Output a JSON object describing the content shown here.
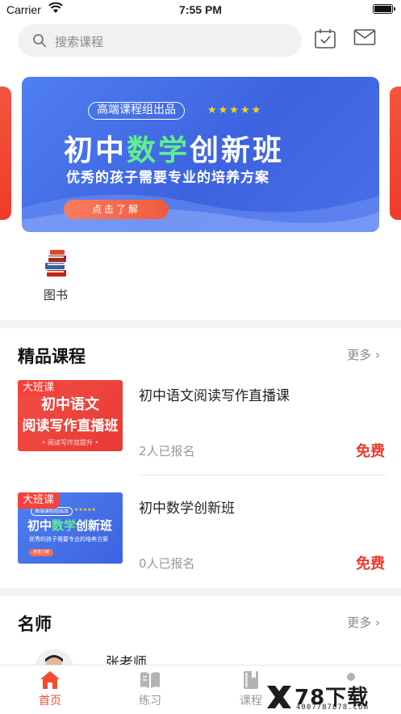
{
  "status_bar": {
    "carrier": "Carrier",
    "time": "7:55 PM"
  },
  "search": {
    "placeholder": "搜索课程"
  },
  "header_icons": [
    "calendar-check-icon",
    "mail-icon"
  ],
  "banner": {
    "tag": "高端课程组出品",
    "stars": "★★★★★",
    "headline_prefix": "初中",
    "headline_highlight": "数学",
    "headline_suffix": "创新班",
    "subtitle": "优秀的孩子需要专业的培养方案",
    "cta": "点击了解"
  },
  "categories": [
    {
      "label": "图书",
      "icon": "books-icon"
    }
  ],
  "featured": {
    "title": "精品课程",
    "more": "更多",
    "courses": [
      {
        "badge": "大班课",
        "thumb_line1": "初中语文",
        "thumb_line2": "阅读写作直播班",
        "thumb_line3": "• 阅读写作双提升 •",
        "title": "初中语文阅读写作直播课",
        "enrolled": "2人已报名",
        "price": "免费"
      },
      {
        "badge": "大班课",
        "thumb_tag": "高端课程组出品",
        "thumb_stars": "★★★★★",
        "thumb_prefix": "初中",
        "thumb_highlight": "数学",
        "thumb_suffix": "创新班",
        "thumb_sub": "优秀的孩子需要专业的培养方案",
        "thumb_cta": "点击了解",
        "title": "初中数学创新班",
        "enrolled": "0人已报名",
        "price": "免费"
      }
    ]
  },
  "teachers": {
    "title": "名师",
    "more": "更多",
    "items": [
      {
        "name": "张老师"
      }
    ]
  },
  "tabbar": {
    "items": [
      {
        "label": "首页",
        "icon": "home-icon",
        "active": true
      },
      {
        "label": "练习",
        "icon": "book-open-icon",
        "active": false
      },
      {
        "label": "课程",
        "icon": "notebook-icon",
        "active": false
      }
    ]
  },
  "watermark": {
    "brand": "78下载",
    "url": "4007787878.Com"
  },
  "colors": {
    "accent": "#f24d2e",
    "price": "#f0392b",
    "banner_blue": "#4f7ff0",
    "highlight_green": "#5ff08c"
  }
}
